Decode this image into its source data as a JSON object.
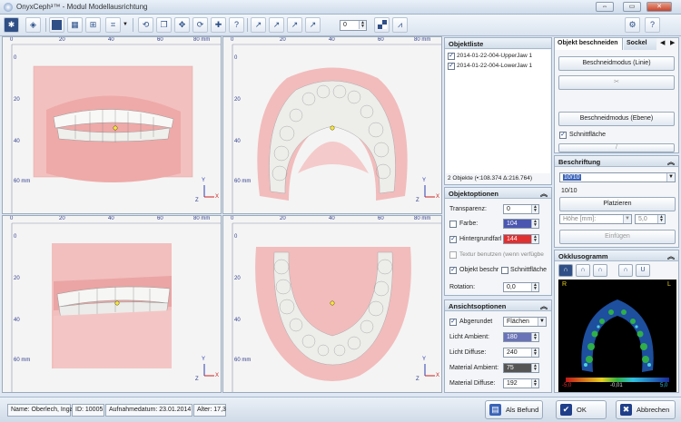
{
  "app": {
    "title": "OnyxCeph³™ - Modul Modellausrichtung",
    "window_buttons": [
      "⇔",
      "▭",
      "✕"
    ]
  },
  "toolbar": {
    "icons": [
      "settings-icon",
      "cube-icon",
      "single-view-icon",
      "quad-view-icon",
      "grid-view-icon",
      "crop-icon",
      "dropdown-arrow-icon",
      "rotate-icon",
      "copy-model-icon",
      "move-model-icon",
      "redo-model-icon",
      "add-point-icon",
      "help-point-icon",
      "axis-x-icon",
      "axis-y-icon",
      "axis-z-icon",
      "axis-all-icon",
      "checker-icon",
      "symmetry-icon"
    ],
    "spin_value": "0",
    "right_icons": [
      "settings-icon",
      "help-icon"
    ]
  },
  "viewports": {
    "ruler_labels_top": [
      "0",
      "20",
      "40",
      "60",
      "80 mm"
    ],
    "ruler_labels_left_1": [
      "0",
      "20",
      "40",
      "60 mm"
    ],
    "ruler_labels_left_2": [
      "0",
      "20",
      "40",
      "60 mm"
    ],
    "ruler_labels_left_3": [
      "0",
      "20",
      "40",
      "60 mm"
    ],
    "ruler_labels_left_4": [
      "0",
      "20",
      "40",
      "60 mm"
    ],
    "axis_labels_front": [
      "Y",
      "Z",
      "X"
    ],
    "axis_labels_top": [
      "Y",
      "Z",
      "X"
    ],
    "axis_labels_side": [
      "Y",
      "Z",
      "X"
    ],
    "axis_labels_bottom": [
      "Y",
      "Z",
      "X"
    ]
  },
  "objektliste": {
    "title": "Objektliste",
    "items": [
      "2014-01-22-004-UpperJaw 1",
      "2014-01-22-004-LowerJaw 1"
    ],
    "status": "2 Objekte (•:108.374 Δ:216.764)"
  },
  "objektoptionen": {
    "title": "Objektoptionen",
    "transparenz_label": "Transparenz:",
    "transparenz_value": "0",
    "farbe_label": "Farbe:",
    "farbe_value": "104",
    "hintergrund_label": "Hintergrundfarl",
    "hintergrund_value": "144",
    "textur_label": "Textur benutzen (wenn verfügbe",
    "objekt_beschr_label": "Objekt beschr",
    "schnittflaeche_label": "Schnittfläche",
    "rotation_label": "Rotation:",
    "rotation_value": "0,0",
    "colors": {
      "farbe": "#4a56b0",
      "hintergrund": "#e03030"
    }
  },
  "ansichtsoptionen": {
    "title": "Ansichtsoptionen",
    "abgerundet_label": "Abgerundet",
    "abgerundet_value": "Flächen",
    "licht_ambient_label": "Licht Ambient:",
    "licht_ambient_value": "180",
    "licht_diffuse_label": "Licht Diffuse:",
    "licht_diffuse_value": "240",
    "material_ambient_label": "Material Ambient:",
    "material_ambient_value": "75",
    "material_diffuse_label": "Material Diffuse:",
    "material_diffuse_value": "192",
    "colors": {
      "licht_ambient": "#6a72b8",
      "material_ambient": "#555555"
    }
  },
  "objekt_beschneiden": {
    "tab_active": "Objekt beschneiden",
    "tab_inactive": "Sockel",
    "btn_linie": "Beschneidmodus (Linie)",
    "btn_ebene": "Beschneidmodus (Ebene)",
    "schnittflaeche_label": "Schnittfläche"
  },
  "beschriftung": {
    "title": "Beschriftung",
    "combo_value": "10/10",
    "text": "10/10",
    "btn_platzieren": "Platzieren",
    "hoehe_label": "Höhe [mm]:",
    "hoehe_value": "5,0",
    "btn_einfuegen": "Einfügen"
  },
  "okklusogramm": {
    "title": "Okklusogramm",
    "label_r": "R",
    "label_l": "L",
    "scale_min": "-5,0",
    "scale_mid": "-0,01",
    "scale_max": "5,0"
  },
  "status": {
    "name": "Name: Oberlech, Inga",
    "id": "ID: 10005",
    "aufnahme": "Aufnahmedatum: 23.01.2014",
    "alter": "Alter: 17,3",
    "btn_befund": "Als Befund",
    "btn_ok": "OK",
    "btn_abbrechen": "Abbrechen"
  }
}
